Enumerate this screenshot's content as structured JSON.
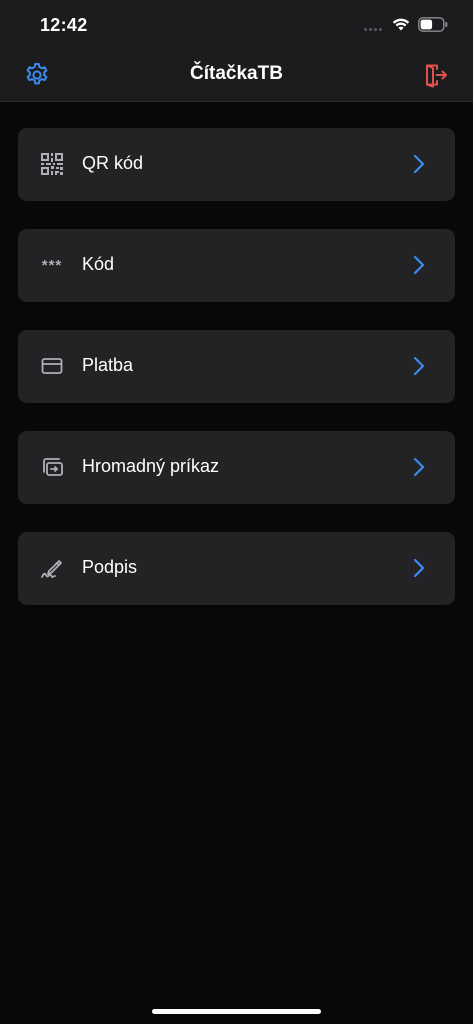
{
  "status_bar": {
    "time": "12:42"
  },
  "nav": {
    "title": "ČítačkaTB",
    "settings_icon": "gear-icon",
    "logout_icon": "logout-icon",
    "accent_color": "#3a8bef",
    "logout_color": "#e0524f"
  },
  "menu": {
    "items": [
      {
        "label": "QR kód",
        "icon": "qr-code-icon"
      },
      {
        "label": "Kód",
        "icon": "asterisks-icon",
        "icon_text": "***"
      },
      {
        "label": "Platba",
        "icon": "card-icon"
      },
      {
        "label": "Hromadný príkaz",
        "icon": "batch-transfer-icon"
      },
      {
        "label": "Podpis",
        "icon": "signature-icon"
      }
    ],
    "chevron_color": "#3a8bef"
  }
}
